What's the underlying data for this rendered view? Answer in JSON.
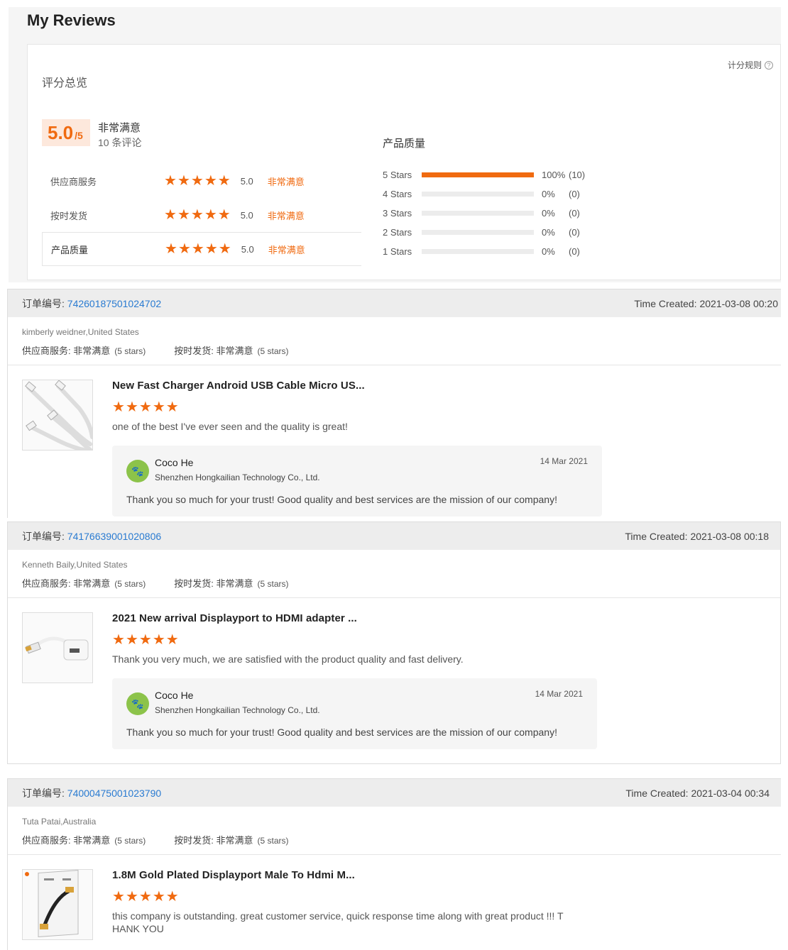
{
  "page": {
    "title": "My Reviews"
  },
  "summary": {
    "title": "评分总览",
    "rules_label": "计分规则",
    "score": "5.0",
    "score_max": "/5",
    "overall_label": "非常满意",
    "review_count": "10 条评论",
    "ratings": [
      {
        "name": "供应商服务",
        "value": "5.0",
        "text": "非常满意",
        "stars": 5
      },
      {
        "name": "按时发货",
        "value": "5.0",
        "text": "非常满意",
        "stars": 5
      },
      {
        "name": "产品质量",
        "value": "5.0",
        "text": "非常满意",
        "stars": 5
      }
    ],
    "distribution_title": "产品质量",
    "distribution": [
      {
        "label": "5 Stars",
        "fraction": 1.0,
        "percent": "100%",
        "count": "(10)"
      },
      {
        "label": "4 Stars",
        "fraction": 0.0,
        "percent": "0%",
        "count": "(0)"
      },
      {
        "label": "3 Stars",
        "fraction": 0.0,
        "percent": "0%",
        "count": "(0)"
      },
      {
        "label": "2 Stars",
        "fraction": 0.0,
        "percent": "0%",
        "count": "(0)"
      },
      {
        "label": "1 Stars",
        "fraction": 0.0,
        "percent": "0%",
        "count": "(0)"
      }
    ]
  },
  "orders": [
    {
      "order_label": "订单编号: ",
      "order_id": "74260187501024702",
      "time_created": "Time Created: 2021-03-08 00:20",
      "buyer": "kimberly weidner,United States",
      "supplier_rating": "供应商服务: 非常满意",
      "supplier_stars": "(5 stars)",
      "shipping_rating": "按时发货: 非常满意",
      "shipping_stars": "(5 stars)",
      "product_title": "New Fast Charger Android USB Cable Micro US...",
      "product_stars": 5,
      "comment": "one of the best I've ever seen and the quality is great!",
      "reply": {
        "name": "Coco He",
        "company": "Shenzhen Hongkailian Technology Co., Ltd.",
        "date": "14 Mar 2021",
        "text": "Thank you so much for your trust! Good quality and best services are the mission of our company!"
      }
    },
    {
      "order_label": "订单编号: ",
      "order_id": "74176639001020806",
      "time_created": "Time Created: 2021-03-08 00:18",
      "buyer": "Kenneth Baily,United States",
      "supplier_rating": "供应商服务: 非常满意",
      "supplier_stars": "(5 stars)",
      "shipping_rating": "按时发货: 非常满意",
      "shipping_stars": "(5 stars)",
      "product_title": "2021 New arrival Displayport to HDMI adapter ...",
      "product_stars": 5,
      "comment": "Thank you very much, we are satisfied with the product quality and fast delivery.",
      "reply": {
        "name": "Coco He",
        "company": "Shenzhen Hongkailian Technology Co., Ltd.",
        "date": "14 Mar 2021",
        "text": "Thank you so much for your trust! Good quality and best services are the mission of our company!"
      }
    },
    {
      "order_label": "订单编号: ",
      "order_id": "74000475001023790",
      "time_created": "Time Created: 2021-03-04 00:34",
      "buyer": "Tuta Patai,Australia",
      "supplier_rating": "供应商服务: 非常满意",
      "supplier_stars": "(5 stars)",
      "shipping_rating": "按时发货: 非常满意",
      "shipping_stars": "(5 stars)",
      "product_title": "1.8M Gold Plated Displayport Male To Hdmi M...",
      "product_stars": 5,
      "comment": "this company is outstanding.  great customer service, quick response time along with great product !!! THANK YOU"
    }
  ],
  "colors": {
    "accent": "#f06a10",
    "link": "#2a7bd1",
    "header_bg": "#ededed"
  }
}
